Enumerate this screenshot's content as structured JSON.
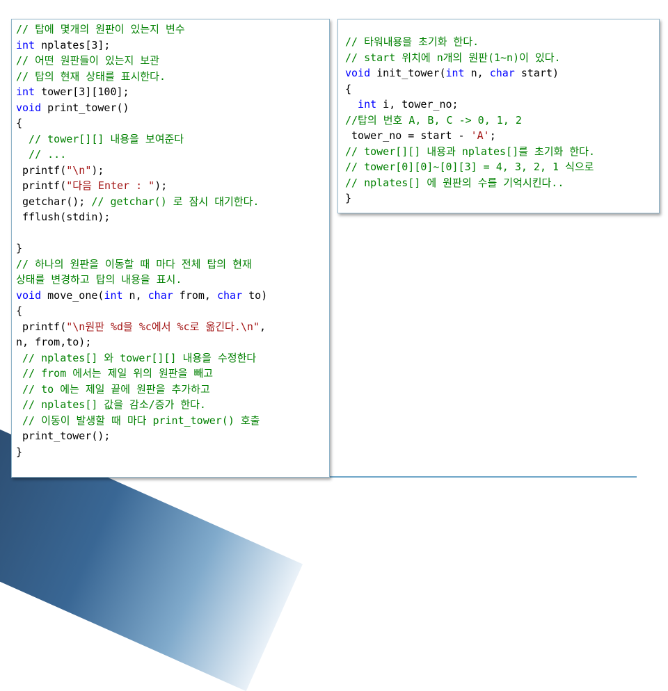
{
  "colors": {
    "comment": "#008000",
    "plain": "#000000",
    "keyword": "#0000ff",
    "string": "#a31515",
    "box_border": "#8fb3c8",
    "accent_band": "#2f5f8f"
  },
  "left_code": [
    [
      {
        "t": "// 탑에 몇개의 원판이 있는지 변수",
        "k": "comment"
      }
    ],
    [
      {
        "t": "int",
        "k": "keyword"
      },
      {
        "t": " nplates[3];",
        "k": "plain"
      }
    ],
    [
      {
        "t": "// 어떤 원판들이 있는지 보관",
        "k": "comment"
      }
    ],
    [
      {
        "t": "// 탑의 현재 상태를 표시한다.",
        "k": "comment"
      }
    ],
    [
      {
        "t": "int",
        "k": "keyword"
      },
      {
        "t": " tower[3][100];",
        "k": "plain"
      }
    ],
    [
      {
        "t": "void",
        "k": "keyword"
      },
      {
        "t": " print_tower()",
        "k": "plain"
      }
    ],
    [
      {
        "t": "{",
        "k": "plain"
      }
    ],
    [
      {
        "t": "  // tower[][] 내용을 보여준다",
        "k": "comment"
      }
    ],
    [
      {
        "t": "  // ...",
        "k": "comment"
      }
    ],
    [
      {
        "t": " printf(",
        "k": "plain"
      },
      {
        "t": "\"\\n\"",
        "k": "string"
      },
      {
        "t": ");",
        "k": "plain"
      }
    ],
    [
      {
        "t": " printf(",
        "k": "plain"
      },
      {
        "t": "\"다음 Enter : \"",
        "k": "string"
      },
      {
        "t": ");",
        "k": "plain"
      }
    ],
    [
      {
        "t": " getchar(); ",
        "k": "plain"
      },
      {
        "t": "// getchar() 로 잠시 대기한다.",
        "k": "comment"
      }
    ],
    [
      {
        "t": " fflush(stdin);",
        "k": "plain"
      }
    ],
    [
      {
        "t": "",
        "k": "plain"
      }
    ],
    [
      {
        "t": "}",
        "k": "plain"
      }
    ],
    [
      {
        "t": "// 하나의 원판을 이동할 때 마다 전체 탑의 현재",
        "k": "comment"
      }
    ],
    [
      {
        "t": "상태를 변경하고 탑의 내용을 표시.",
        "k": "comment"
      }
    ],
    [
      {
        "t": "void",
        "k": "keyword"
      },
      {
        "t": " move_one(",
        "k": "plain"
      },
      {
        "t": "int",
        "k": "keyword"
      },
      {
        "t": " n, ",
        "k": "plain"
      },
      {
        "t": "char",
        "k": "keyword"
      },
      {
        "t": " from, ",
        "k": "plain"
      },
      {
        "t": "char",
        "k": "keyword"
      },
      {
        "t": " to)",
        "k": "plain"
      }
    ],
    [
      {
        "t": "{",
        "k": "plain"
      }
    ],
    [
      {
        "t": " printf(",
        "k": "plain"
      },
      {
        "t": "\"\\n원판 %d을 %c에서 %c로 옮긴다.\\n\"",
        "k": "string"
      },
      {
        "t": ",",
        "k": "plain"
      }
    ],
    [
      {
        "t": "n, from,to);",
        "k": "plain"
      }
    ],
    [
      {
        "t": " // nplates[] 와 tower[][] 내용을 수정한다",
        "k": "comment"
      }
    ],
    [
      {
        "t": " // from 에서는 제일 위의 원판을 빼고",
        "k": "comment"
      }
    ],
    [
      {
        "t": " // to 에는 제일 끝에 원판을 추가하고",
        "k": "comment"
      }
    ],
    [
      {
        "t": " // nplates[] 값을 감소/증가 한다.",
        "k": "comment"
      }
    ],
    [
      {
        "t": " // 이동이 발생할 때 마다 print_tower() 호출",
        "k": "comment"
      }
    ],
    [
      {
        "t": " print_tower();",
        "k": "plain"
      }
    ],
    [
      {
        "t": "}",
        "k": "plain"
      }
    ]
  ],
  "right_code": [
    [
      {
        "t": "// 타워내용을 초기화 한다.",
        "k": "comment"
      }
    ],
    [
      {
        "t": "// start 위치에 n개의 원판(1~n)이 있다.",
        "k": "comment"
      }
    ],
    [
      {
        "t": "void",
        "k": "keyword"
      },
      {
        "t": " init_tower(",
        "k": "plain"
      },
      {
        "t": "int",
        "k": "keyword"
      },
      {
        "t": " n, ",
        "k": "plain"
      },
      {
        "t": "char",
        "k": "keyword"
      },
      {
        "t": " start)",
        "k": "plain"
      }
    ],
    [
      {
        "t": "{",
        "k": "plain"
      }
    ],
    [
      {
        "t": "  int",
        "k": "keyword"
      },
      {
        "t": " i, tower_no;",
        "k": "plain"
      }
    ],
    [
      {
        "t": "//탑의 번호 A, B, C -> 0, 1, 2",
        "k": "comment"
      }
    ],
    [
      {
        "t": " tower_no = start - ",
        "k": "plain"
      },
      {
        "t": "'A'",
        "k": "string"
      },
      {
        "t": ";",
        "k": "plain"
      }
    ],
    [
      {
        "t": "// tower[][] 내용과 nplates[]를 초기화 한다.",
        "k": "comment"
      }
    ],
    [
      {
        "t": "// tower[0][0]~[0][3] = 4, 3, 2, 1 식으로",
        "k": "comment"
      }
    ],
    [
      {
        "t": "// nplates[] 에 원판의 수를 기억시킨다..",
        "k": "comment"
      }
    ],
    [
      {
        "t": "}",
        "k": "plain"
      }
    ]
  ]
}
